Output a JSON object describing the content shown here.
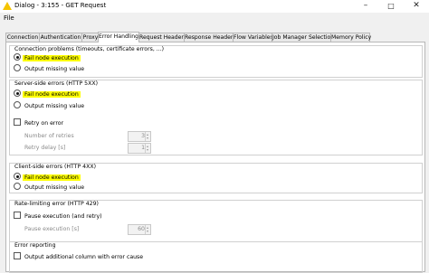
{
  "window": {
    "title": "Dialog - 3:155 - GET Request"
  },
  "menu": {
    "file": "File"
  },
  "tabs": [
    {
      "label": "Connection"
    },
    {
      "label": "Authentication"
    },
    {
      "label": "Proxy"
    },
    {
      "label": "Error Handling",
      "active": true
    },
    {
      "label": "Request Headers"
    },
    {
      "label": "Response Headers"
    },
    {
      "label": "Flow Variables"
    },
    {
      "label": "Job Manager Selection"
    },
    {
      "label": "Memory Policy"
    }
  ],
  "connection": {
    "title": "Connection problems (timeouts, certificate errors, ...)",
    "fail": "Fail node execution",
    "missing": "Output missing value",
    "selected": "fail"
  },
  "server": {
    "title": "Server-side errors (HTTP 5XX)",
    "fail": "Fail node execution",
    "missing": "Output missing value",
    "selected": "fail",
    "retry_label": "Retry on error",
    "retry_checked": false,
    "retries_label": "Number of retries",
    "retries_value": "3",
    "delay_label": "Retry delay [s]",
    "delay_value": "1"
  },
  "client": {
    "title": "Client-side errors (HTTP 4XX)",
    "fail": "Fail node execution",
    "missing": "Output missing value",
    "selected": "fail"
  },
  "ratelimit": {
    "title": "Rate-limiting error (HTTP 429)",
    "pause_label": "Pause execution (and retry)",
    "pause_checked": false,
    "duration_label": "Pause execution [s]",
    "duration_value": "60"
  },
  "reporting": {
    "title": "Error reporting",
    "output_label": "Output additional column with error cause",
    "output_checked": false
  },
  "colors": {
    "highlight": "#ffff00",
    "disabled_text": "#8a8a8a"
  }
}
